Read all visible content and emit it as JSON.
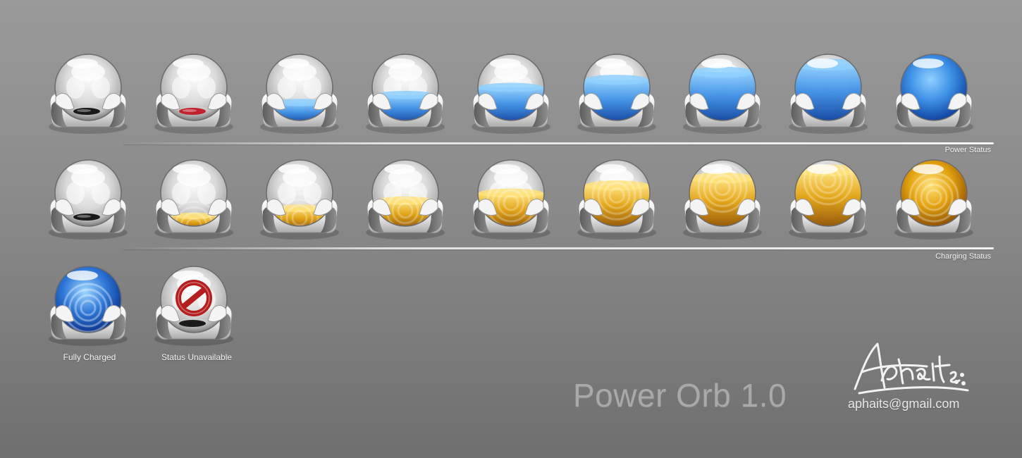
{
  "rows": [
    {
      "label": "Power Status",
      "theme": "blue",
      "liquid_colors": {
        "light": "#8fd0ff",
        "mid": "#3d8fe6",
        "dark": "#0b3d9a"
      },
      "levels": [
        0,
        0.125,
        0.25,
        0.375,
        0.5,
        0.625,
        0.75,
        0.875,
        1.0
      ],
      "empty_level_color": "#c0232e"
    },
    {
      "label": "Charging Status",
      "theme": "amber",
      "liquid_colors": {
        "light": "#ffe27a",
        "mid": "#e3a20f",
        "dark": "#8a4c03"
      },
      "levels": [
        0,
        0.125,
        0.25,
        0.375,
        0.5,
        0.625,
        0.75,
        0.875,
        1.0
      ]
    }
  ],
  "special": [
    {
      "caption": "Fully Charged",
      "state": "charged",
      "color": "#2f78d8"
    },
    {
      "caption": "Status Unavailable",
      "state": "unavailable",
      "color": "#b41e1e"
    }
  ],
  "title": "Power Orb 1.0",
  "author": {
    "email": "aphaits@gmail.com",
    "signature": "Aphaits"
  }
}
